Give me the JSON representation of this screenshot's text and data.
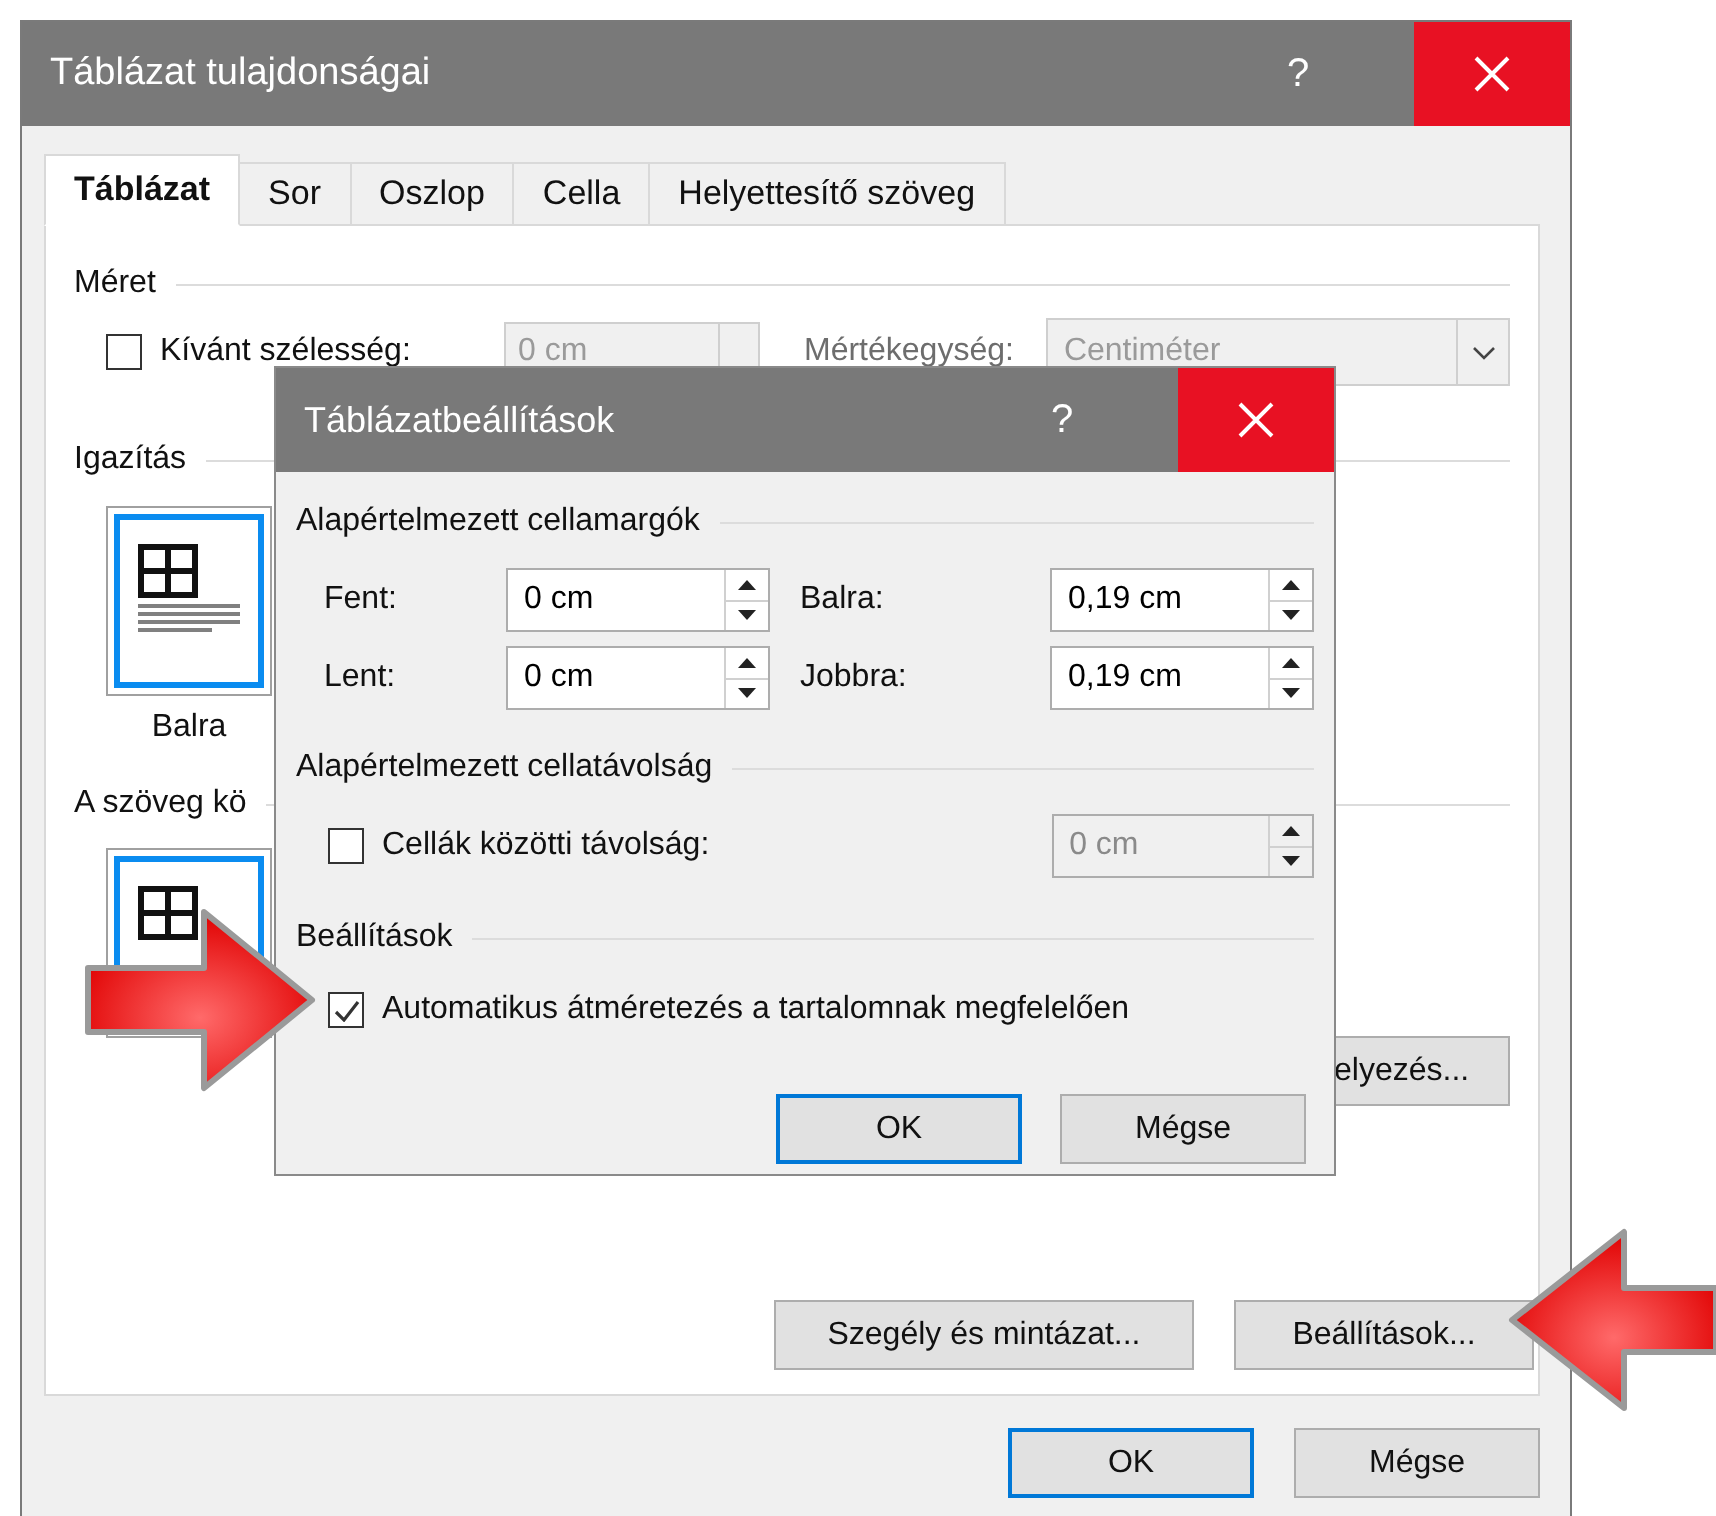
{
  "main_window": {
    "title": "Táblázat tulajdonságai",
    "help": "?",
    "tabs": [
      {
        "label": "Táblázat",
        "selected": true
      },
      {
        "label": "Sor",
        "selected": false
      },
      {
        "label": "Oszlop",
        "selected": false
      },
      {
        "label": "Cella",
        "selected": false
      },
      {
        "label": "Helyettesítő szöveg",
        "selected": false
      }
    ],
    "size": {
      "label": "Méret",
      "preferred_width": {
        "label": "Kívánt szélesség:",
        "checked": false,
        "value": "0 cm",
        "disabled": true
      },
      "unit": {
        "label": "Mértékegység:",
        "value": "Centiméter",
        "disabled": true
      }
    },
    "alignment": {
      "label": "Igazítás",
      "option": {
        "label": "Balra",
        "selected": true
      }
    },
    "text_wrap": {
      "label": "A szöveg kö",
      "option": {
        "selected": true
      }
    },
    "positioning_button": "elyezés...",
    "panel_buttons": [
      "Szegély és mintázat...",
      "Beállítások..."
    ],
    "footer_buttons": [
      {
        "label": "OK",
        "default": true
      },
      {
        "label": "Mégse",
        "default": false
      }
    ]
  },
  "settings_dialog": {
    "title": "Táblázatbeállítások",
    "help": "?",
    "margins": {
      "label": "Alapértelmezett cellamargók",
      "fields": [
        {
          "label": "Fent:",
          "value": "0 cm"
        },
        {
          "label": "Balra:",
          "value": "0,19 cm"
        },
        {
          "label": "Lent:",
          "value": "0 cm"
        },
        {
          "label": "Jobbra:",
          "value": "0,19 cm"
        }
      ]
    },
    "spacing": {
      "label": "Alapértelmezett cellatávolság",
      "option": {
        "label": "Cellák közötti távolság:",
        "checked": false
      },
      "field": {
        "value": "0 cm",
        "disabled": true
      }
    },
    "options": {
      "label": "Beállítások",
      "option": {
        "label": "Automatikus átméretezés a tartalomnak megfelelően",
        "checked": true
      }
    },
    "buttons": [
      {
        "label": "OK",
        "default": true
      },
      {
        "label": "Mégse",
        "default": false
      }
    ]
  }
}
